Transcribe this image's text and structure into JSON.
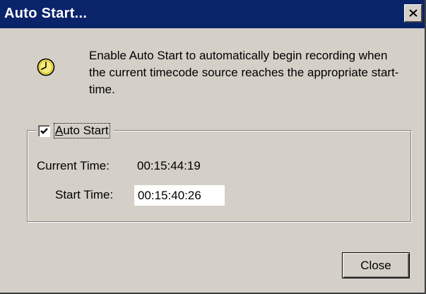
{
  "window": {
    "title": "Auto Start...",
    "colors": {
      "titlebar": "#0a246a",
      "face": "#d4d0c8"
    }
  },
  "icons": {
    "info": "clock-icon",
    "close": "close-x-icon"
  },
  "description": "Enable Auto Start to automatically begin recording when the current timecode source reaches the appropriate start-time.",
  "auto_start": {
    "checkbox_label_mnemonic": "A",
    "checkbox_label_rest": "uto Start",
    "checked": true
  },
  "current_time": {
    "label": "Current Time:",
    "value": "00:15:44:19"
  },
  "start_time": {
    "label": "Start Time:",
    "value": "00:15:40:26"
  },
  "buttons": {
    "close": "Close"
  }
}
